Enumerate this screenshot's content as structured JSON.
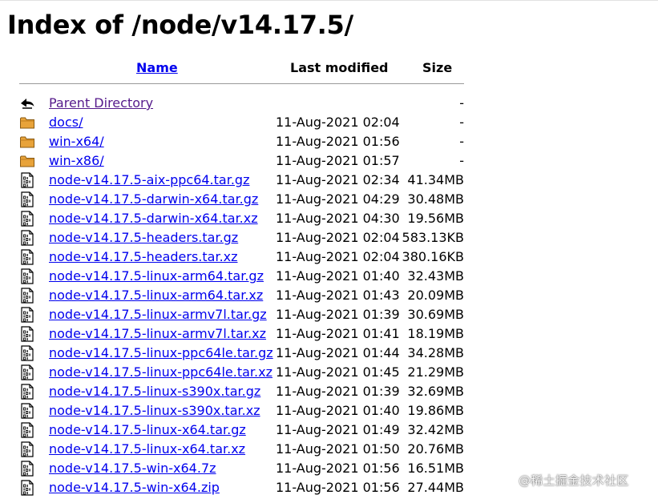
{
  "page": {
    "title": "Index of /node/v14.17.5/"
  },
  "table": {
    "headers": {
      "name": "Name",
      "last_modified": "Last modified",
      "size": "Size"
    },
    "rows": [
      {
        "icon": "back-arrow-icon",
        "name": "Parent Directory",
        "modified": "",
        "size": "-",
        "kind": "parent"
      },
      {
        "icon": "folder-icon",
        "name": "docs/",
        "modified": "11-Aug-2021 02:04",
        "size": "-",
        "kind": "folder"
      },
      {
        "icon": "folder-icon",
        "name": "win-x64/",
        "modified": "11-Aug-2021 01:56",
        "size": "-",
        "kind": "folder"
      },
      {
        "icon": "folder-icon",
        "name": "win-x86/",
        "modified": "11-Aug-2021 01:57",
        "size": "-",
        "kind": "folder"
      },
      {
        "icon": "binary-file-icon",
        "name": "node-v14.17.5-aix-ppc64.tar.gz",
        "modified": "11-Aug-2021 02:34",
        "size": "41.34MB",
        "kind": "file"
      },
      {
        "icon": "binary-file-icon",
        "name": "node-v14.17.5-darwin-x64.tar.gz",
        "modified": "11-Aug-2021 04:29",
        "size": "30.48MB",
        "kind": "file"
      },
      {
        "icon": "binary-file-icon",
        "name": "node-v14.17.5-darwin-x64.tar.xz",
        "modified": "11-Aug-2021 04:30",
        "size": "19.56MB",
        "kind": "file"
      },
      {
        "icon": "binary-file-icon",
        "name": "node-v14.17.5-headers.tar.gz",
        "modified": "11-Aug-2021 02:04",
        "size": "583.13KB",
        "kind": "file"
      },
      {
        "icon": "binary-file-icon",
        "name": "node-v14.17.5-headers.tar.xz",
        "modified": "11-Aug-2021 02:04",
        "size": "380.16KB",
        "kind": "file"
      },
      {
        "icon": "binary-file-icon",
        "name": "node-v14.17.5-linux-arm64.tar.gz",
        "modified": "11-Aug-2021 01:40",
        "size": "32.43MB",
        "kind": "file"
      },
      {
        "icon": "binary-file-icon",
        "name": "node-v14.17.5-linux-arm64.tar.xz",
        "modified": "11-Aug-2021 01:43",
        "size": "20.09MB",
        "kind": "file"
      },
      {
        "icon": "binary-file-icon",
        "name": "node-v14.17.5-linux-armv7l.tar.gz",
        "modified": "11-Aug-2021 01:39",
        "size": "30.69MB",
        "kind": "file"
      },
      {
        "icon": "binary-file-icon",
        "name": "node-v14.17.5-linux-armv7l.tar.xz",
        "modified": "11-Aug-2021 01:41",
        "size": "18.19MB",
        "kind": "file"
      },
      {
        "icon": "binary-file-icon",
        "name": "node-v14.17.5-linux-ppc64le.tar.gz",
        "modified": "11-Aug-2021 01:44",
        "size": "34.28MB",
        "kind": "file"
      },
      {
        "icon": "binary-file-icon",
        "name": "node-v14.17.5-linux-ppc64le.tar.xz",
        "modified": "11-Aug-2021 01:45",
        "size": "21.29MB",
        "kind": "file"
      },
      {
        "icon": "binary-file-icon",
        "name": "node-v14.17.5-linux-s390x.tar.gz",
        "modified": "11-Aug-2021 01:39",
        "size": "32.69MB",
        "kind": "file"
      },
      {
        "icon": "binary-file-icon",
        "name": "node-v14.17.5-linux-s390x.tar.xz",
        "modified": "11-Aug-2021 01:40",
        "size": "19.86MB",
        "kind": "file"
      },
      {
        "icon": "binary-file-icon",
        "name": "node-v14.17.5-linux-x64.tar.gz",
        "modified": "11-Aug-2021 01:49",
        "size": "32.42MB",
        "kind": "file"
      },
      {
        "icon": "binary-file-icon",
        "name": "node-v14.17.5-linux-x64.tar.xz",
        "modified": "11-Aug-2021 01:50",
        "size": "20.76MB",
        "kind": "file"
      },
      {
        "icon": "binary-file-icon",
        "name": "node-v14.17.5-win-x64.7z",
        "modified": "11-Aug-2021 01:56",
        "size": "16.51MB",
        "kind": "file"
      },
      {
        "icon": "binary-file-icon",
        "name": "node-v14.17.5-win-x64.zip",
        "modified": "11-Aug-2021 01:56",
        "size": "27.44MB",
        "kind": "file"
      }
    ]
  },
  "watermark": {
    "text": "@稀土掘金技术社区"
  },
  "colors": {
    "link": "#0000ee",
    "visited_link": "#551a8b",
    "folder_fill": "#e8a33a",
    "rule": "#9a9a9a"
  }
}
